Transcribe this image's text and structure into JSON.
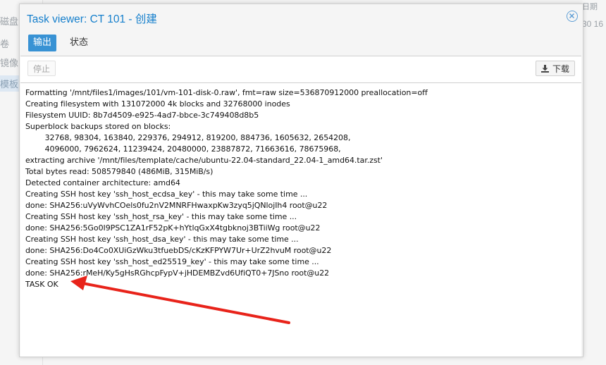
{
  "background": {
    "left_items": [
      "磁盘",
      "卷",
      "镜像",
      "模板"
    ],
    "right_header": "日期",
    "right_text": "30 16"
  },
  "dialog": {
    "title": "Task viewer: CT 101 - 创建",
    "tabs": [
      {
        "label": "输出",
        "active": true
      },
      {
        "label": "状态",
        "active": false
      }
    ],
    "toolbar": {
      "stop_label": "停止",
      "download_label": "下载"
    },
    "log_lines": [
      "Formatting '/mnt/files1/images/101/vm-101-disk-0.raw', fmt=raw size=536870912000 preallocation=off",
      "Creating filesystem with 131072000 4k blocks and 32768000 inodes",
      "Filesystem UUID: 8b7d4509-e925-4ad7-bbce-3c749408d8b5",
      "Superblock backups stored on blocks:",
      "        32768, 98304, 163840, 229376, 294912, 819200, 884736, 1605632, 2654208,",
      "        4096000, 7962624, 11239424, 20480000, 23887872, 71663616, 78675968,",
      "extracting archive '/mnt/files/template/cache/ubuntu-22.04-standard_22.04-1_amd64.tar.zst'",
      "Total bytes read: 508579840 (486MiB, 315MiB/s)",
      "Detected container architecture: amd64",
      "Creating SSH host key 'ssh_host_ecdsa_key' - this may take some time ...",
      "done: SHA256:uVyWvhCOels0fu2nV2MNRFHwaxpKw3zyq5jQNlojIh4 root@u22",
      "Creating SSH host key 'ssh_host_rsa_key' - this may take some time ...",
      "done: SHA256:5Go0I9PSC1ZA1rF52pK+hYtlqGxX4tgbknoj3BTiiWg root@u22",
      "Creating SSH host key 'ssh_host_dsa_key' - this may take some time ...",
      "done: SHA256:Do4Co0XUiGzWku3tfuebDS/cKzKFPYW7Ur+UrZ2hvuM root@u22",
      "Creating SSH host key 'ssh_host_ed25519_key' - this may take some time ...",
      "done: SHA256:rMeH/Ky5gHsRGhcpFypV+jHDEMBZvd6UfiQT0+7JSno root@u22",
      "TASK OK"
    ]
  },
  "colors": {
    "accent": "#157fcc",
    "tab_active": "#3892d4",
    "annotation_arrow": "#e8231a"
  },
  "icons": {
    "close": "close-circle-icon",
    "download": "download-icon"
  }
}
